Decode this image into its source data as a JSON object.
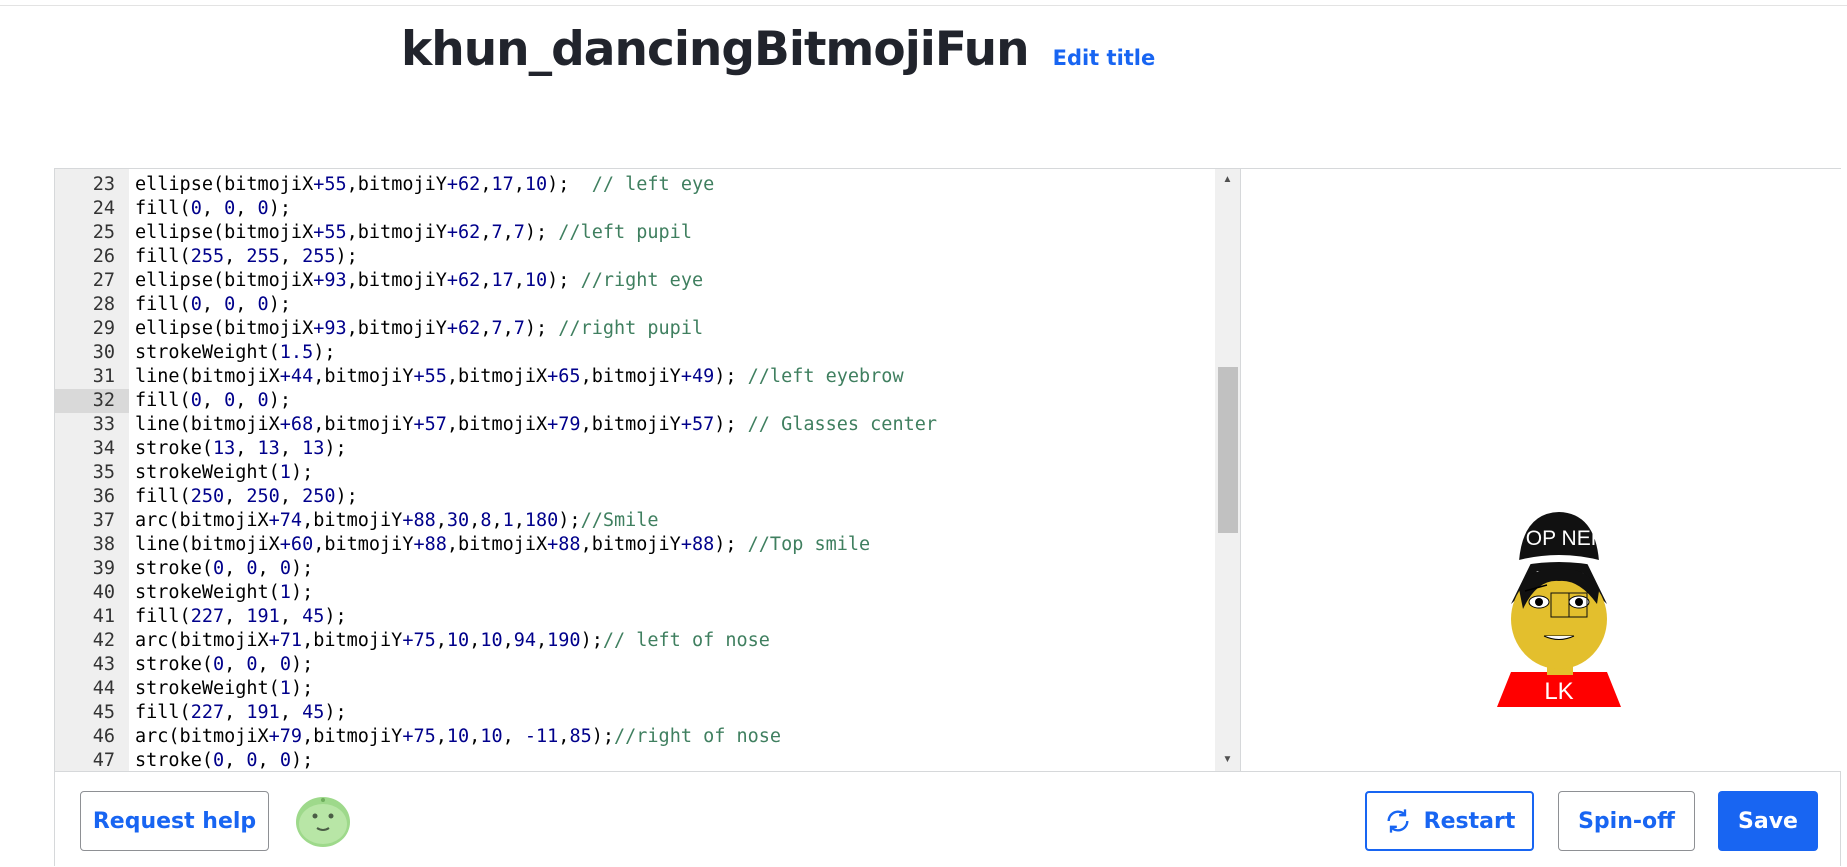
{
  "header": {
    "title": "khun_dancingBitmojiFun",
    "edit_title_label": "Edit title"
  },
  "editor": {
    "active_line": 32,
    "lines": [
      {
        "n": "23",
        "parts": [
          [
            "t",
            "ellipse(bitmojiX"
          ],
          [
            "n",
            "+55"
          ],
          [
            "t",
            ",bitmojiY"
          ],
          [
            "n",
            "+62"
          ],
          [
            "t",
            ","
          ],
          [
            "n",
            "17"
          ],
          [
            "t",
            ","
          ],
          [
            "n",
            "10"
          ],
          [
            "t",
            ");  "
          ],
          [
            "c",
            "// left eye"
          ]
        ]
      },
      {
        "n": "24",
        "parts": [
          [
            "t",
            "fill("
          ],
          [
            "n",
            "0"
          ],
          [
            "t",
            ", "
          ],
          [
            "n",
            "0"
          ],
          [
            "t",
            ", "
          ],
          [
            "n",
            "0"
          ],
          [
            "t",
            ");"
          ]
        ]
      },
      {
        "n": "25",
        "parts": [
          [
            "t",
            "ellipse(bitmojiX"
          ],
          [
            "n",
            "+55"
          ],
          [
            "t",
            ",bitmojiY"
          ],
          [
            "n",
            "+62"
          ],
          [
            "t",
            ","
          ],
          [
            "n",
            "7"
          ],
          [
            "t",
            ","
          ],
          [
            "n",
            "7"
          ],
          [
            "t",
            "); "
          ],
          [
            "c",
            "//left pupil"
          ]
        ]
      },
      {
        "n": "26",
        "parts": [
          [
            "t",
            "fill("
          ],
          [
            "n",
            "255"
          ],
          [
            "t",
            ", "
          ],
          [
            "n",
            "255"
          ],
          [
            "t",
            ", "
          ],
          [
            "n",
            "255"
          ],
          [
            "t",
            ");"
          ]
        ]
      },
      {
        "n": "27",
        "parts": [
          [
            "t",
            "ellipse(bitmojiX"
          ],
          [
            "n",
            "+93"
          ],
          [
            "t",
            ",bitmojiY"
          ],
          [
            "n",
            "+62"
          ],
          [
            "t",
            ","
          ],
          [
            "n",
            "17"
          ],
          [
            "t",
            ","
          ],
          [
            "n",
            "10"
          ],
          [
            "t",
            "); "
          ],
          [
            "c",
            "//right eye"
          ]
        ]
      },
      {
        "n": "28",
        "parts": [
          [
            "t",
            "fill("
          ],
          [
            "n",
            "0"
          ],
          [
            "t",
            ", "
          ],
          [
            "n",
            "0"
          ],
          [
            "t",
            ", "
          ],
          [
            "n",
            "0"
          ],
          [
            "t",
            ");"
          ]
        ]
      },
      {
        "n": "29",
        "parts": [
          [
            "t",
            "ellipse(bitmojiX"
          ],
          [
            "n",
            "+93"
          ],
          [
            "t",
            ",bitmojiY"
          ],
          [
            "n",
            "+62"
          ],
          [
            "t",
            ","
          ],
          [
            "n",
            "7"
          ],
          [
            "t",
            ","
          ],
          [
            "n",
            "7"
          ],
          [
            "t",
            "); "
          ],
          [
            "c",
            "//right pupil"
          ]
        ]
      },
      {
        "n": "30",
        "parts": [
          [
            "t",
            "strokeWeight("
          ],
          [
            "n",
            "1.5"
          ],
          [
            "t",
            ");"
          ]
        ]
      },
      {
        "n": "31",
        "parts": [
          [
            "t",
            "line(bitmojiX"
          ],
          [
            "n",
            "+44"
          ],
          [
            "t",
            ",bitmojiY"
          ],
          [
            "n",
            "+55"
          ],
          [
            "t",
            ",bitmojiX"
          ],
          [
            "n",
            "+65"
          ],
          [
            "t",
            ",bitmojiY"
          ],
          [
            "n",
            "+49"
          ],
          [
            "t",
            "); "
          ],
          [
            "c",
            "//left eyebrow"
          ]
        ]
      },
      {
        "n": "32",
        "parts": [
          [
            "t",
            "fill("
          ],
          [
            "n",
            "0"
          ],
          [
            "t",
            ", "
          ],
          [
            "n",
            "0"
          ],
          [
            "t",
            ", "
          ],
          [
            "n",
            "0"
          ],
          [
            "t",
            ");"
          ]
        ]
      },
      {
        "n": "33",
        "parts": [
          [
            "t",
            "line(bitmojiX"
          ],
          [
            "n",
            "+68"
          ],
          [
            "t",
            ",bitmojiY"
          ],
          [
            "n",
            "+57"
          ],
          [
            "t",
            ",bitmojiX"
          ],
          [
            "n",
            "+79"
          ],
          [
            "t",
            ",bitmojiY"
          ],
          [
            "n",
            "+57"
          ],
          [
            "t",
            "); "
          ],
          [
            "c",
            "// Glasses center"
          ]
        ]
      },
      {
        "n": "34",
        "parts": [
          [
            "t",
            "stroke("
          ],
          [
            "n",
            "13"
          ],
          [
            "t",
            ", "
          ],
          [
            "n",
            "13"
          ],
          [
            "t",
            ", "
          ],
          [
            "n",
            "13"
          ],
          [
            "t",
            ");"
          ]
        ]
      },
      {
        "n": "35",
        "parts": [
          [
            "t",
            "strokeWeight("
          ],
          [
            "n",
            "1"
          ],
          [
            "t",
            ");"
          ]
        ]
      },
      {
        "n": "36",
        "parts": [
          [
            "t",
            "fill("
          ],
          [
            "n",
            "250"
          ],
          [
            "t",
            ", "
          ],
          [
            "n",
            "250"
          ],
          [
            "t",
            ", "
          ],
          [
            "n",
            "250"
          ],
          [
            "t",
            ");"
          ]
        ]
      },
      {
        "n": "37",
        "parts": [
          [
            "t",
            "arc(bitmojiX"
          ],
          [
            "n",
            "+74"
          ],
          [
            "t",
            ",bitmojiY"
          ],
          [
            "n",
            "+88"
          ],
          [
            "t",
            ","
          ],
          [
            "n",
            "30"
          ],
          [
            "t",
            ","
          ],
          [
            "n",
            "8"
          ],
          [
            "t",
            ","
          ],
          [
            "n",
            "1"
          ],
          [
            "t",
            ","
          ],
          [
            "n",
            "180"
          ],
          [
            "t",
            ");"
          ],
          [
            "c",
            "//Smile"
          ]
        ]
      },
      {
        "n": "38",
        "parts": [
          [
            "t",
            "line(bitmojiX"
          ],
          [
            "n",
            "+60"
          ],
          [
            "t",
            ",bitmojiY"
          ],
          [
            "n",
            "+88"
          ],
          [
            "t",
            ",bitmojiX"
          ],
          [
            "n",
            "+88"
          ],
          [
            "t",
            ",bitmojiY"
          ],
          [
            "n",
            "+88"
          ],
          [
            "t",
            "); "
          ],
          [
            "c",
            "//Top smile"
          ]
        ]
      },
      {
        "n": "39",
        "parts": [
          [
            "t",
            "stroke("
          ],
          [
            "n",
            "0"
          ],
          [
            "t",
            ", "
          ],
          [
            "n",
            "0"
          ],
          [
            "t",
            ", "
          ],
          [
            "n",
            "0"
          ],
          [
            "t",
            ");"
          ]
        ]
      },
      {
        "n": "40",
        "parts": [
          [
            "t",
            "strokeWeight("
          ],
          [
            "n",
            "1"
          ],
          [
            "t",
            ");"
          ]
        ]
      },
      {
        "n": "41",
        "parts": [
          [
            "t",
            "fill("
          ],
          [
            "n",
            "227"
          ],
          [
            "t",
            ", "
          ],
          [
            "n",
            "191"
          ],
          [
            "t",
            ", "
          ],
          [
            "n",
            "45"
          ],
          [
            "t",
            ");"
          ]
        ]
      },
      {
        "n": "42",
        "parts": [
          [
            "t",
            "arc(bitmojiX"
          ],
          [
            "n",
            "+71"
          ],
          [
            "t",
            ",bitmojiY"
          ],
          [
            "n",
            "+75"
          ],
          [
            "t",
            ","
          ],
          [
            "n",
            "10"
          ],
          [
            "t",
            ","
          ],
          [
            "n",
            "10"
          ],
          [
            "t",
            ","
          ],
          [
            "n",
            "94"
          ],
          [
            "t",
            ","
          ],
          [
            "n",
            "190"
          ],
          [
            "t",
            ");"
          ],
          [
            "c",
            "// left of nose"
          ]
        ]
      },
      {
        "n": "43",
        "parts": [
          [
            "t",
            "stroke("
          ],
          [
            "n",
            "0"
          ],
          [
            "t",
            ", "
          ],
          [
            "n",
            "0"
          ],
          [
            "t",
            ", "
          ],
          [
            "n",
            "0"
          ],
          [
            "t",
            ");"
          ]
        ]
      },
      {
        "n": "44",
        "parts": [
          [
            "t",
            "strokeWeight("
          ],
          [
            "n",
            "1"
          ],
          [
            "t",
            ");"
          ]
        ]
      },
      {
        "n": "45",
        "parts": [
          [
            "t",
            "fill("
          ],
          [
            "n",
            "227"
          ],
          [
            "t",
            ", "
          ],
          [
            "n",
            "191"
          ],
          [
            "t",
            ", "
          ],
          [
            "n",
            "45"
          ],
          [
            "t",
            ");"
          ]
        ]
      },
      {
        "n": "46",
        "parts": [
          [
            "t",
            "arc(bitmojiX"
          ],
          [
            "n",
            "+79"
          ],
          [
            "t",
            ",bitmojiY"
          ],
          [
            "n",
            "+75"
          ],
          [
            "t",
            ","
          ],
          [
            "n",
            "10"
          ],
          [
            "t",
            ","
          ],
          [
            "n",
            "10"
          ],
          [
            "t",
            ", "
          ],
          [
            "n",
            "-11"
          ],
          [
            "t",
            ","
          ],
          [
            "n",
            "85"
          ],
          [
            "t",
            ");"
          ],
          [
            "c",
            "//right of nose"
          ]
        ]
      },
      {
        "n": "47",
        "parts": [
          [
            "t",
            "stroke("
          ],
          [
            "n",
            "0"
          ],
          [
            "t",
            ", "
          ],
          [
            "n",
            "0"
          ],
          [
            "t",
            ", "
          ],
          [
            "n",
            "0"
          ],
          [
            "t",
            ");"
          ]
        ]
      }
    ]
  },
  "canvas": {
    "hat_text": "TOP NEP",
    "shirt_text": "LK",
    "colors": {
      "hat": "#111111",
      "skin": "#e3bf2d",
      "shirt": "#ff0000",
      "hat_band": "#ffffff"
    }
  },
  "bottom_bar": {
    "request_help_label": "Request help",
    "restart_label": "Restart",
    "spinoff_label": "Spin-off",
    "save_label": "Save"
  },
  "icons": {
    "restart": "refresh-icon",
    "scroll_up": "arrow-up-icon",
    "scroll_down": "arrow-down-icon",
    "avatar": "avatar-icon"
  }
}
